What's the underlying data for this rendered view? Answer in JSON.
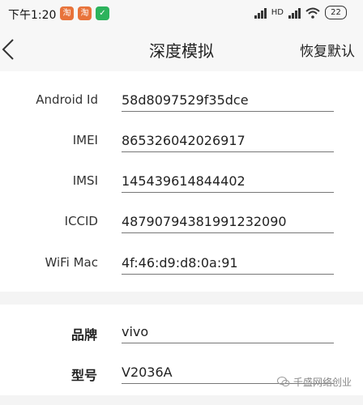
{
  "status": {
    "time": "下午1:20",
    "network_label": "HD",
    "battery": "22",
    "colors": {
      "app_orange": "#e8733a",
      "app_green": "#2cb35c"
    }
  },
  "nav": {
    "title": "深度模拟",
    "reset_label": "恢复默认"
  },
  "device_fields": [
    {
      "label": "Android Id",
      "value": "58d8097529f35dce"
    },
    {
      "label": "IMEI",
      "value": "865326042026917"
    },
    {
      "label": "IMSI",
      "value": "145439614844402"
    },
    {
      "label": "ICCID",
      "value": "48790794381991232090"
    },
    {
      "label": "WiFi Mac",
      "value": "4f:46:d9:d8:0a:91"
    }
  ],
  "model_fields": [
    {
      "label": "品牌",
      "value": "vivo"
    },
    {
      "label": "型号",
      "value": "V2036A"
    }
  ],
  "watermark": {
    "text": "千盛网络创业"
  }
}
